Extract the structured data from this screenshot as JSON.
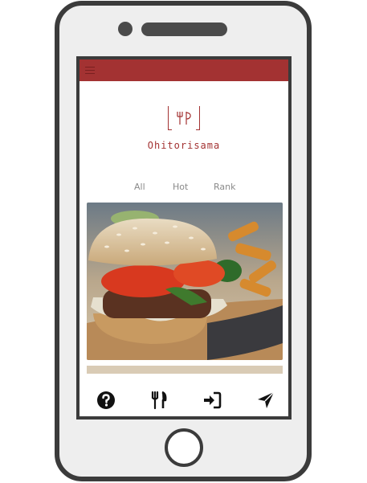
{
  "app": {
    "name": "Ohitorisama"
  },
  "tabs": [
    {
      "label": "All"
    },
    {
      "label": "Hot"
    },
    {
      "label": "Rank"
    }
  ],
  "feed": {
    "items": [
      {
        "image": "burger-photo"
      }
    ]
  },
  "bottom_nav": [
    {
      "icon": "help-icon"
    },
    {
      "icon": "fork-knife-icon"
    },
    {
      "icon": "sign-in-icon"
    },
    {
      "icon": "send-icon"
    }
  ],
  "colors": {
    "brand": "#a33232",
    "phone_frame": "#3b3b3b",
    "tab_text": "#8a8a8a"
  }
}
